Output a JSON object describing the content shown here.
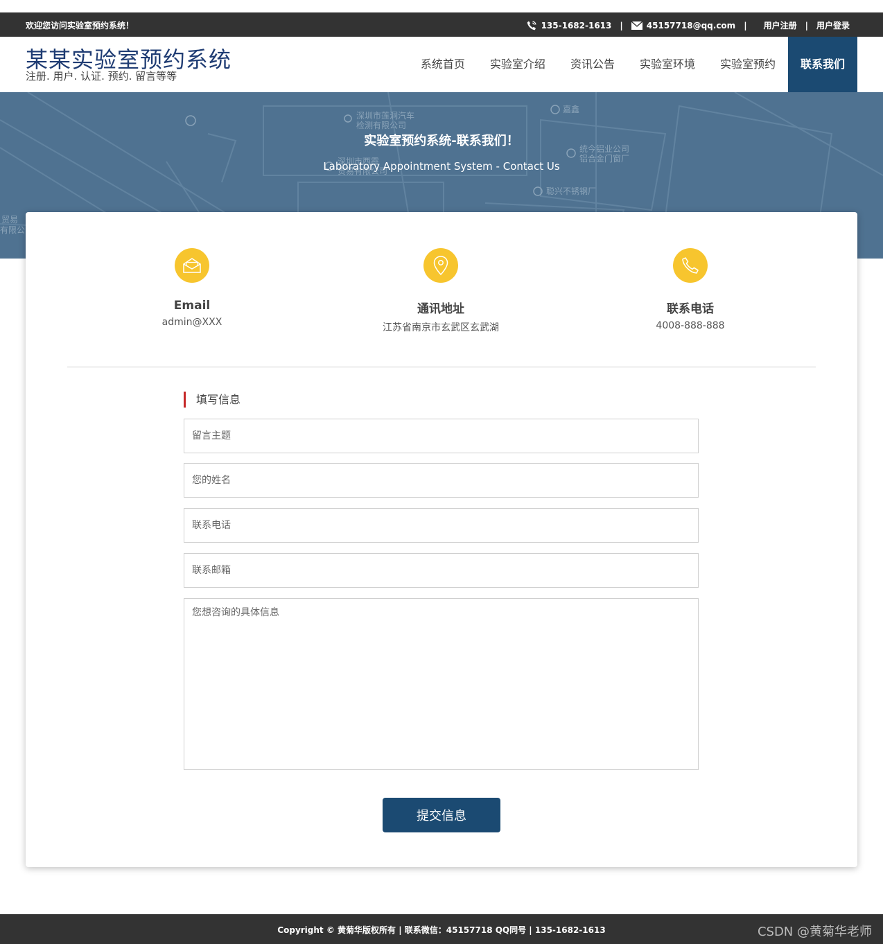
{
  "topbar": {
    "welcome": "欢迎您访问实验室预约系统！",
    "phone": "135-1682-1613",
    "email": "45157718@qq.com",
    "sep": "|",
    "register": "用户注册",
    "login": "用户登录"
  },
  "header": {
    "title": "某某实验室预约系统",
    "subtitle": "注册. 用户. 认证. 预约. 留言等等"
  },
  "nav": {
    "items": [
      "系统首页",
      "实验室介绍",
      "资讯公告",
      "实验室环境",
      "实验室预约",
      "联系我们"
    ],
    "active_index": 5
  },
  "banner": {
    "title": "实验室预约系统-联系我们！",
    "subtitle": "Laboratory Appointment System - Contact Us",
    "map_labels": [
      "深圳市莲洞汽车",
      "检测有限公司",
      "嘉鑫",
      "统今铝业公司",
      "铝合金门窗厂",
      "深圳市西霞",
      "贵易有限公司",
      "聪兴不锈钢厂",
      "贸易",
      "有限公"
    ]
  },
  "contact": {
    "email_label": "Email",
    "email_value": "admin@XXX",
    "address_label": "通讯地址",
    "address_value": "江苏省南京市玄武区玄武湖",
    "phone_label": "联系电话",
    "phone_value": "4008-888-888"
  },
  "form": {
    "title": "填写信息",
    "subject_placeholder": "留言主题",
    "name_placeholder": "您的姓名",
    "phone_placeholder": "联系电话",
    "email_placeholder": "联系邮箱",
    "message_placeholder": "您想咨询的具体信息",
    "submit_label": "提交信息"
  },
  "footer": {
    "copyright": "Copyright © 黄菊华版权所有 | 联系微信：45157718 QQ同号 | 135-1682-1613",
    "watermark": "CSDN @黄菊华老师"
  },
  "colors": {
    "accent": "#1b4a72",
    "icon_bg": "#f7c52e",
    "bar_bg": "#333333",
    "banner_bg": "#4f7291",
    "title_marker": "#c62828"
  }
}
